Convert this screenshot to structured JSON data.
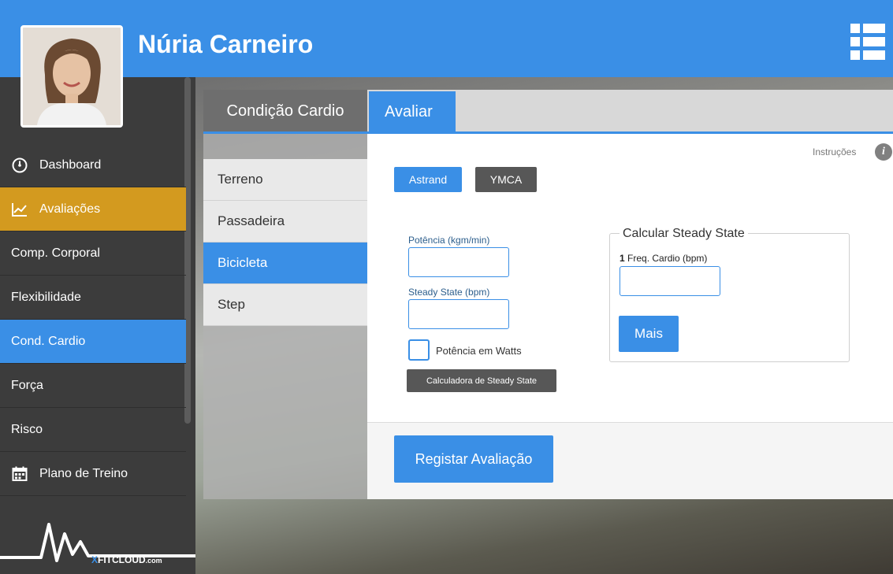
{
  "header": {
    "user_name": "Núria Carneiro",
    "menu_icon": "list-menu-icon",
    "avatar_icon": "profile-photo"
  },
  "sidebar": {
    "items": [
      {
        "label": "Dashboard",
        "icon": "dashboard-gauge-icon"
      },
      {
        "label": "Avaliações",
        "icon": "line-chart-icon"
      },
      {
        "label": "Comp. Corporal"
      },
      {
        "label": "Flexibilidade"
      },
      {
        "label": "Cond. Cardio"
      },
      {
        "label": "Força"
      },
      {
        "label": "Risco"
      },
      {
        "label": "Plano de Treino",
        "icon": "calendar-icon"
      }
    ],
    "logo": {
      "x": "X",
      "fit": "FITCLOUD",
      "dom": ".com"
    }
  },
  "tabs": {
    "section_title": "Condição Cardio",
    "active_tab": "Avaliar"
  },
  "subnav": {
    "items": [
      "Terreno",
      "Passadeira",
      "Bicicleta",
      "Step"
    ],
    "selected": "Bicicleta"
  },
  "form": {
    "instructions": "Instruções",
    "info_icon": "info-icon",
    "protocol_buttons": {
      "astrand": "Astrand",
      "ymca": "YMCA"
    },
    "potencia_label": "Potência (kgm/min)",
    "potencia_value": "",
    "steady_label": "Steady State (bpm)",
    "steady_value": "",
    "watts_checkbox_label": "Potência em Watts",
    "watts_checked": false,
    "calc_button": "Calculadora de Steady State",
    "steady_box": {
      "title": "Calcular Steady State",
      "index": "1",
      "freq_label": "Freq. Cardio (bpm)",
      "freq_value": "",
      "more_button": "Mais"
    },
    "submit_button": "Registar Avaliação"
  },
  "colors": {
    "primary": "#3a8fe6",
    "accent": "#d39a1f",
    "dark": "#3c3c3c",
    "button_gray": "#575757"
  }
}
